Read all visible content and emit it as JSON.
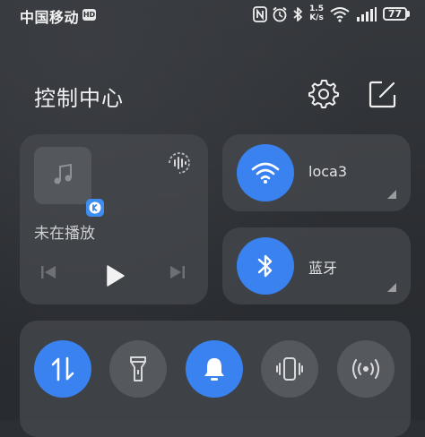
{
  "status_bar": {
    "carrier": "中国移动",
    "hd": "HD",
    "speed_value": "1.5",
    "speed_unit": "K/s",
    "battery": "77",
    "icons": [
      "nfc-icon",
      "alarm-icon",
      "bluetooth-icon",
      "wifi-icon",
      "signal-icon",
      "battery-icon"
    ]
  },
  "header": {
    "title": "控制中心",
    "settings_icon": "gear-icon",
    "edit_icon": "edit-icon"
  },
  "media": {
    "status": "未在播放",
    "app_badge_icon": "k-app-icon",
    "controls": [
      "previous-icon",
      "play-icon",
      "next-icon"
    ]
  },
  "wifi": {
    "label": "loca3",
    "active": true,
    "icon": "wifi-icon"
  },
  "bluetooth": {
    "label": "蓝牙",
    "active": true,
    "icon": "bluetooth-icon"
  },
  "toggles": [
    {
      "name": "mobile-data",
      "icon": "data-arrows-icon",
      "active": true
    },
    {
      "name": "flashlight",
      "icon": "flashlight-icon",
      "active": false
    },
    {
      "name": "ring",
      "icon": "bell-icon",
      "active": true
    },
    {
      "name": "vibrate",
      "icon": "vibrate-icon",
      "active": false
    },
    {
      "name": "hotspot",
      "icon": "hotspot-icon",
      "active": false
    }
  ],
  "colors": {
    "accent": "#3a82f0",
    "card": "#46494e",
    "inactive": "#55585d"
  }
}
